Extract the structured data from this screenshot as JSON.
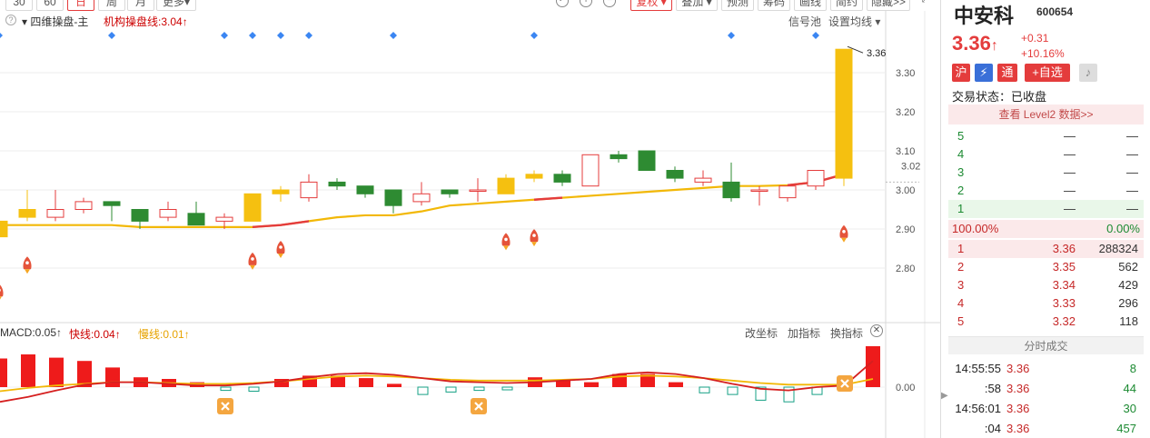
{
  "toolbar": {
    "buttons": [
      "30",
      "60",
      "日",
      "周",
      "月",
      "更多▾"
    ],
    "right_buttons": [
      "复权 ▾",
      "叠加 ▾",
      "预测",
      "筹码",
      "画线",
      "简约",
      "隐藏>>"
    ]
  },
  "main_chart": {
    "indicator_name": "四维操盘-主",
    "indicator_value": "机构操盘线:3.04↑",
    "signal_pool": "信号池",
    "set_ma": "设置均线 ▾",
    "price_label": "3.36",
    "current_price_axis": "3.02",
    "help_icon": "?"
  },
  "macd": {
    "macd_label": "MACD:0.05↑",
    "fast_label": "快线:0.04↑",
    "slow_label": "慢线:0.01↑",
    "btn_coord": "改坐标",
    "btn_add": "加指标",
    "btn_switch": "换指标",
    "zero_label": "0.00"
  },
  "chart_data": {
    "type": "candlestick",
    "y_axis_ticks": [
      "3.30",
      "3.20",
      "3.10",
      "3.00",
      "2.90",
      "2.80"
    ],
    "y_axis_values": [
      3.3,
      3.2,
      3.1,
      3.0,
      2.9,
      2.8
    ],
    "candles": [
      {
        "o": 2.88,
        "c": 2.92,
        "h": 2.94,
        "l": 2.87,
        "color": "yellow"
      },
      {
        "o": 2.93,
        "c": 2.95,
        "h": 3.0,
        "l": 2.92,
        "color": "yellow"
      },
      {
        "o": 2.93,
        "c": 2.95,
        "h": 3.0,
        "l": 2.92,
        "color": "red_hollow"
      },
      {
        "o": 2.95,
        "c": 2.97,
        "h": 2.98,
        "l": 2.94,
        "color": "red_hollow"
      },
      {
        "o": 2.97,
        "c": 2.96,
        "h": 2.97,
        "l": 2.92,
        "color": "green"
      },
      {
        "o": 2.95,
        "c": 2.92,
        "h": 2.95,
        "l": 2.9,
        "color": "green"
      },
      {
        "o": 2.93,
        "c": 2.95,
        "h": 2.97,
        "l": 2.92,
        "color": "red_hollow"
      },
      {
        "o": 2.94,
        "c": 2.91,
        "h": 2.97,
        "l": 2.91,
        "color": "green"
      },
      {
        "o": 2.92,
        "c": 2.93,
        "h": 2.94,
        "l": 2.9,
        "color": "red_hollow"
      },
      {
        "o": 2.92,
        "c": 2.99,
        "h": 2.99,
        "l": 2.92,
        "color": "yellow"
      },
      {
        "o": 2.99,
        "c": 3.0,
        "h": 3.01,
        "l": 2.97,
        "color": "yellow"
      },
      {
        "o": 2.98,
        "c": 3.02,
        "h": 3.04,
        "l": 2.97,
        "color": "red_hollow"
      },
      {
        "o": 3.02,
        "c": 3.01,
        "h": 3.03,
        "l": 3.0,
        "color": "green"
      },
      {
        "o": 3.01,
        "c": 2.99,
        "h": 3.01,
        "l": 2.98,
        "color": "green"
      },
      {
        "o": 3.0,
        "c": 2.96,
        "h": 3.0,
        "l": 2.94,
        "color": "green"
      },
      {
        "o": 2.97,
        "c": 2.99,
        "h": 3.02,
        "l": 2.96,
        "color": "red_hollow"
      },
      {
        "o": 3.0,
        "c": 2.99,
        "h": 3.0,
        "l": 2.98,
        "color": "green"
      },
      {
        "o": 3.0,
        "c": 3.0,
        "h": 3.03,
        "l": 2.97,
        "color": "red_line"
      },
      {
        "o": 2.99,
        "c": 3.03,
        "h": 3.04,
        "l": 2.99,
        "color": "yellow"
      },
      {
        "o": 3.03,
        "c": 3.04,
        "h": 3.05,
        "l": 3.02,
        "color": "yellow"
      },
      {
        "o": 3.04,
        "c": 3.02,
        "h": 3.05,
        "l": 3.01,
        "color": "green"
      },
      {
        "o": 3.01,
        "c": 3.09,
        "h": 3.09,
        "l": 3.01,
        "color": "red_hollow"
      },
      {
        "o": 3.09,
        "c": 3.08,
        "h": 3.1,
        "l": 3.07,
        "color": "green"
      },
      {
        "o": 3.1,
        "c": 3.05,
        "h": 3.1,
        "l": 3.05,
        "color": "green"
      },
      {
        "o": 3.05,
        "c": 3.03,
        "h": 3.06,
        "l": 3.02,
        "color": "green"
      },
      {
        "o": 3.02,
        "c": 3.03,
        "h": 3.05,
        "l": 3.01,
        "color": "red_hollow"
      },
      {
        "o": 3.02,
        "c": 2.98,
        "h": 3.07,
        "l": 2.97,
        "color": "green"
      },
      {
        "o": 3.0,
        "c": 3.0,
        "h": 3.01,
        "l": 2.96,
        "color": "red_line"
      },
      {
        "o": 2.98,
        "c": 3.01,
        "h": 3.01,
        "l": 2.97,
        "color": "red_hollow"
      },
      {
        "o": 3.01,
        "c": 3.05,
        "h": 3.05,
        "l": 3.0,
        "color": "red_hollow"
      },
      {
        "o": 3.03,
        "c": 3.36,
        "h": 3.36,
        "l": 3.01,
        "color": "yellow"
      }
    ],
    "ma_line": [
      2.91,
      2.91,
      2.91,
      2.91,
      2.91,
      2.905,
      2.905,
      2.905,
      2.905,
      2.905,
      2.91,
      2.92,
      2.93,
      2.935,
      2.935,
      2.945,
      2.96,
      2.965,
      2.97,
      2.975,
      2.98,
      2.985,
      2.99,
      2.995,
      3.0,
      3.005,
      3.01,
      3.01,
      3.012,
      3.02,
      3.04
    ],
    "ma_red_segments": [
      [
        9,
        11
      ],
      [
        19,
        20
      ],
      [
        28,
        30
      ]
    ],
    "diamond_markers": [
      0,
      4,
      8,
      9,
      10,
      11,
      14,
      19,
      26,
      29
    ],
    "rocket_markers": [
      {
        "i": 0,
        "v": 2.79
      },
      {
        "i": 1,
        "v": 2.86
      },
      {
        "i": 9,
        "v": 2.87
      },
      {
        "i": 10,
        "v": 2.9
      },
      {
        "i": 18,
        "v": 2.92
      },
      {
        "i": 19,
        "v": 2.93
      },
      {
        "i": 30,
        "v": 2.94
      }
    ],
    "macd_bars": [
      0.035,
      0.04,
      0.036,
      0.032,
      0.024,
      0.012,
      0.01,
      0.006,
      -0.004,
      -0.005,
      0.01,
      0.014,
      0.014,
      0.011,
      0.004,
      -0.009,
      -0.006,
      -0.004,
      -0.002,
      0.012,
      0.008,
      0.006,
      0.016,
      0.016,
      0.006,
      -0.007,
      -0.009,
      -0.016,
      -0.018,
      -0.009,
      -0.002,
      0.05
    ],
    "macd_fast": [
      -0.018,
      -0.012,
      -0.004,
      0.003,
      0.006,
      0.006,
      0.004,
      0.002,
      0.002,
      0.004,
      0.007,
      0.012,
      0.016,
      0.017,
      0.015,
      0.011,
      0.007,
      0.006,
      0.005,
      0.006,
      0.008,
      0.01,
      0.016,
      0.018,
      0.016,
      0.011,
      0.004,
      -0.002,
      -0.004,
      0.0,
      0.002,
      0.032
    ],
    "macd_slow": [
      -0.005,
      -0.001,
      0.002,
      0.004,
      0.006,
      0.006,
      0.005,
      0.004,
      0.004,
      0.005,
      0.007,
      0.01,
      0.013,
      0.014,
      0.013,
      0.011,
      0.009,
      0.008,
      0.008,
      0.008,
      0.009,
      0.01,
      0.013,
      0.014,
      0.013,
      0.011,
      0.008,
      0.005,
      0.003,
      0.003,
      0.003,
      0.01
    ],
    "x_markers": [
      8,
      17,
      29
    ]
  },
  "quote": {
    "name": "中安科",
    "code": "600654",
    "price": "3.36",
    "arrow": "↑",
    "change": "+0.31",
    "change_pct": "+10.16%",
    "tags": [
      "沪",
      "⚡",
      "通",
      "+自选"
    ],
    "state": "交易状态：已收盘",
    "level2": "查看 Level2 数据>>",
    "asks": [
      {
        "lvl": "5",
        "p": "—",
        "v": "—"
      },
      {
        "lvl": "4",
        "p": "—",
        "v": "—"
      },
      {
        "lvl": "3",
        "p": "—",
        "v": "—"
      },
      {
        "lvl": "2",
        "p": "—",
        "v": "—"
      },
      {
        "lvl": "1",
        "p": "—",
        "v": "—"
      }
    ],
    "ratio_left": "100.00%",
    "ratio_right": "0.00%",
    "bids": [
      {
        "lvl": "1",
        "p": "3.36",
        "v": "288324"
      },
      {
        "lvl": "2",
        "p": "3.35",
        "v": "562"
      },
      {
        "lvl": "3",
        "p": "3.34",
        "v": "429"
      },
      {
        "lvl": "4",
        "p": "3.33",
        "v": "296"
      },
      {
        "lvl": "5",
        "p": "3.32",
        "v": "118"
      }
    ],
    "ticks_title": "分时成交",
    "ticks": [
      {
        "t": "14:55:55",
        "p": "3.36",
        "v": "8"
      },
      {
        "t": ":58",
        "p": "3.36",
        "v": "44"
      },
      {
        "t": "14:56:01",
        "p": "3.36",
        "v": "30"
      },
      {
        "t": ":04",
        "p": "3.36",
        "v": "457"
      }
    ]
  },
  "colors": {
    "up": "#e43c3c",
    "down": "#2e8b32",
    "yellow": "#f5c010",
    "ma": "#f2b807",
    "diamond": "#3b86f2"
  }
}
